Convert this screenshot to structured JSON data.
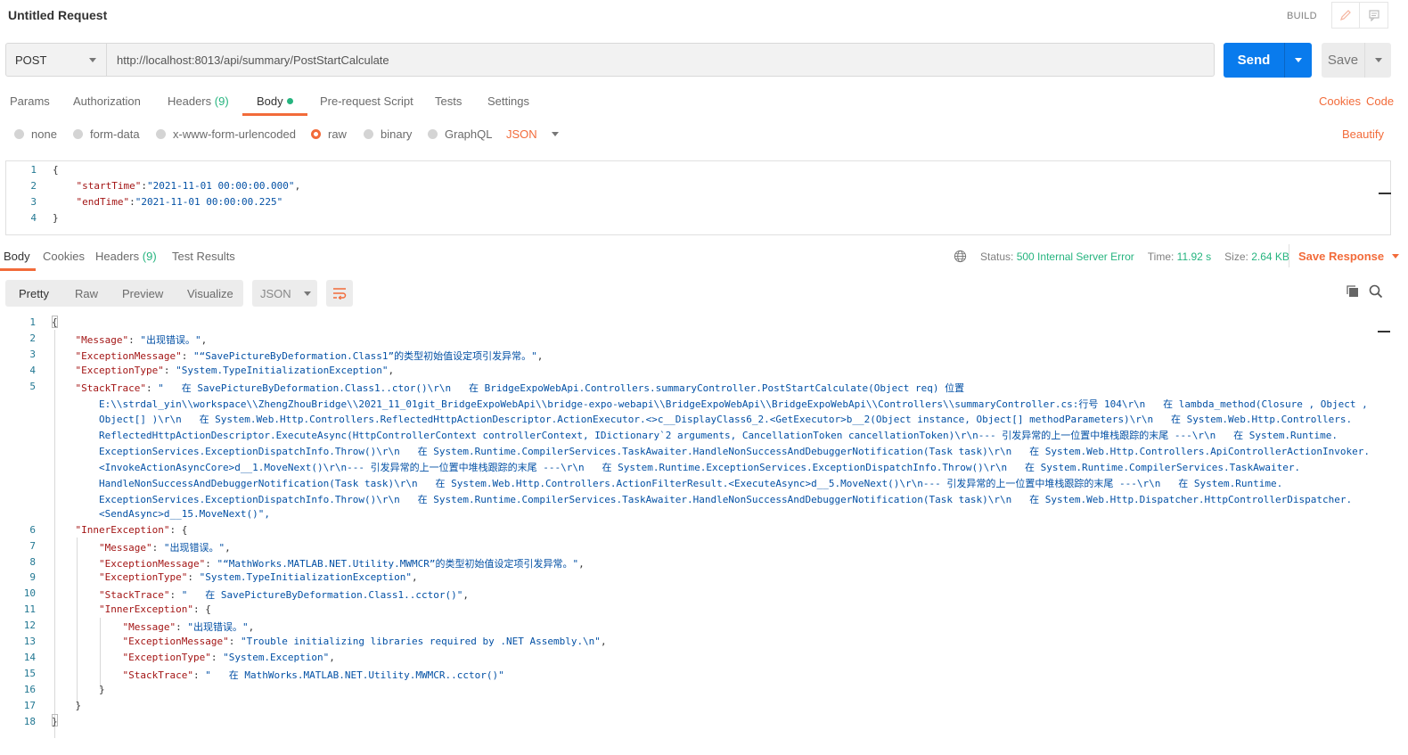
{
  "header": {
    "title": "Untitled Request",
    "build_label": "BUILD",
    "edit_icon": "pencil-icon",
    "comment_icon": "comment-icon"
  },
  "request": {
    "method": "POST",
    "url": "http://localhost:8013/api/summary/PostStartCalculate",
    "send_label": "Send",
    "save_label": "Save"
  },
  "request_tabs": [
    {
      "label": "Params"
    },
    {
      "label": "Authorization"
    },
    {
      "label": "Headers",
      "count": "(9)"
    },
    {
      "label": "Body",
      "active": true
    },
    {
      "label": "Pre-request Script"
    },
    {
      "label": "Tests"
    },
    {
      "label": "Settings"
    }
  ],
  "request_links": {
    "cookies": "Cookies",
    "code": "Code"
  },
  "body_modes": {
    "options": [
      "none",
      "form-data",
      "x-www-form-urlencoded",
      "raw",
      "binary",
      "GraphQL"
    ],
    "selected": "raw",
    "format": "JSON",
    "beautify": "Beautify"
  },
  "request_body": [
    {
      "n": "1",
      "t": "{"
    },
    {
      "n": "2",
      "t": "    \"startTime\":\"2021-11-01 00:00:00.000\","
    },
    {
      "n": "3",
      "t": "    \"endTime\":\"2021-11-01 00:00:00.225\""
    },
    {
      "n": "4",
      "t": "}"
    }
  ],
  "response_tabs": [
    {
      "label": "Body",
      "active": true
    },
    {
      "label": "Cookies"
    },
    {
      "label": "Headers",
      "count": "(9)"
    },
    {
      "label": "Test Results"
    }
  ],
  "response_status": {
    "globe_icon": "globe-icon",
    "status_label": "Status:",
    "status_value": "500 Internal Server Error",
    "time_label": "Time:",
    "time_value": "11.92 s",
    "size_label": "Size:",
    "size_value": "2.64 KB",
    "save_response": "Save Response"
  },
  "view_modes": {
    "options": [
      "Pretty",
      "Raw",
      "Preview",
      "Visualize"
    ],
    "selected": "Pretty",
    "format": "JSON",
    "wrap_icon": "wrap-lines-icon",
    "copy_icon": "copy-icon",
    "search_icon": "search-icon"
  },
  "response_body": [
    {
      "n": "1",
      "t": "{"
    },
    {
      "n": "2",
      "t": "    \"Message\": \"出现错误。\","
    },
    {
      "n": "3",
      "t": "    \"ExceptionMessage\": \"“SavePictureByDeformation.Class1”的类型初始值设定项引发异常。\","
    },
    {
      "n": "4",
      "t": "    \"ExceptionType\": \"System.TypeInitializationException\","
    },
    {
      "n": "5",
      "t": "    \"StackTrace\": \"   在 SavePictureByDeformation.Class1..ctor()\\r\\n   在 BridgeExpoWebApi.Controllers.summaryController.PostStartCalculate(Object req) 位置"
    },
    {
      "n": "",
      "t": "        E:\\\\strdal_yin\\\\workspace\\\\ZhengZhouBridge\\\\2021_11_01git_BridgeExpoWebApi\\\\bridge-expo-webapi\\\\BridgeExpoWebApi\\\\BridgeExpoWebApi\\\\Controllers\\\\summaryController.cs:行号 104\\r\\n   在 lambda_method(Closure , Object ,"
    },
    {
      "n": "",
      "t": "        Object[] )\\r\\n   在 System.Web.Http.Controllers.ReflectedHttpActionDescriptor.ActionExecutor.<>c__DisplayClass6_2.<GetExecutor>b__2(Object instance, Object[] methodParameters)\\r\\n   在 System.Web.Http.Controllers."
    },
    {
      "n": "",
      "t": "        ReflectedHttpActionDescriptor.ExecuteAsync(HttpControllerContext controllerContext, IDictionary`2 arguments, CancellationToken cancellationToken)\\r\\n--- 引发异常的上一位置中堆栈跟踪的末尾 ---\\r\\n   在 System.Runtime."
    },
    {
      "n": "",
      "t": "        ExceptionServices.ExceptionDispatchInfo.Throw()\\r\\n   在 System.Runtime.CompilerServices.TaskAwaiter.HandleNonSuccessAndDebuggerNotification(Task task)\\r\\n   在 System.Web.Http.Controllers.ApiControllerActionInvoker."
    },
    {
      "n": "",
      "t": "        <InvokeActionAsyncCore>d__1.MoveNext()\\r\\n--- 引发异常的上一位置中堆栈跟踪的末尾 ---\\r\\n   在 System.Runtime.ExceptionServices.ExceptionDispatchInfo.Throw()\\r\\n   在 System.Runtime.CompilerServices.TaskAwaiter."
    },
    {
      "n": "",
      "t": "        HandleNonSuccessAndDebuggerNotification(Task task)\\r\\n   在 System.Web.Http.Controllers.ActionFilterResult.<ExecuteAsync>d__5.MoveNext()\\r\\n--- 引发异常的上一位置中堆栈跟踪的末尾 ---\\r\\n   在 System.Runtime."
    },
    {
      "n": "",
      "t": "        ExceptionServices.ExceptionDispatchInfo.Throw()\\r\\n   在 System.Runtime.CompilerServices.TaskAwaiter.HandleNonSuccessAndDebuggerNotification(Task task)\\r\\n   在 System.Web.Http.Dispatcher.HttpControllerDispatcher."
    },
    {
      "n": "",
      "t": "        <SendAsync>d__15.MoveNext()\","
    },
    {
      "n": "6",
      "t": "    \"InnerException\": {"
    },
    {
      "n": "7",
      "t": "        \"Message\": \"出现错误。\","
    },
    {
      "n": "8",
      "t": "        \"ExceptionMessage\": \"“MathWorks.MATLAB.NET.Utility.MWMCR”的类型初始值设定项引发异常。\","
    },
    {
      "n": "9",
      "t": "        \"ExceptionType\": \"System.TypeInitializationException\","
    },
    {
      "n": "10",
      "t": "        \"StackTrace\": \"   在 SavePictureByDeformation.Class1..cctor()\","
    },
    {
      "n": "11",
      "t": "        \"InnerException\": {"
    },
    {
      "n": "12",
      "t": "            \"Message\": \"出现错误。\","
    },
    {
      "n": "13",
      "t": "            \"ExceptionMessage\": \"Trouble initializing libraries required by .NET Assembly.\\n\","
    },
    {
      "n": "14",
      "t": "            \"ExceptionType\": \"System.Exception\","
    },
    {
      "n": "15",
      "t": "            \"StackTrace\": \"   在 MathWorks.MATLAB.NET.Utility.MWMCR..cctor()\""
    },
    {
      "n": "16",
      "t": "        }"
    },
    {
      "n": "17",
      "t": "    }"
    },
    {
      "n": "18",
      "t": "}"
    }
  ],
  "colors": {
    "accent": "#f26b3a",
    "send": "#097bed",
    "success": "#26b47f",
    "json_key": "#a31515",
    "json_string": "#0451a5",
    "line_number": "#237893"
  }
}
